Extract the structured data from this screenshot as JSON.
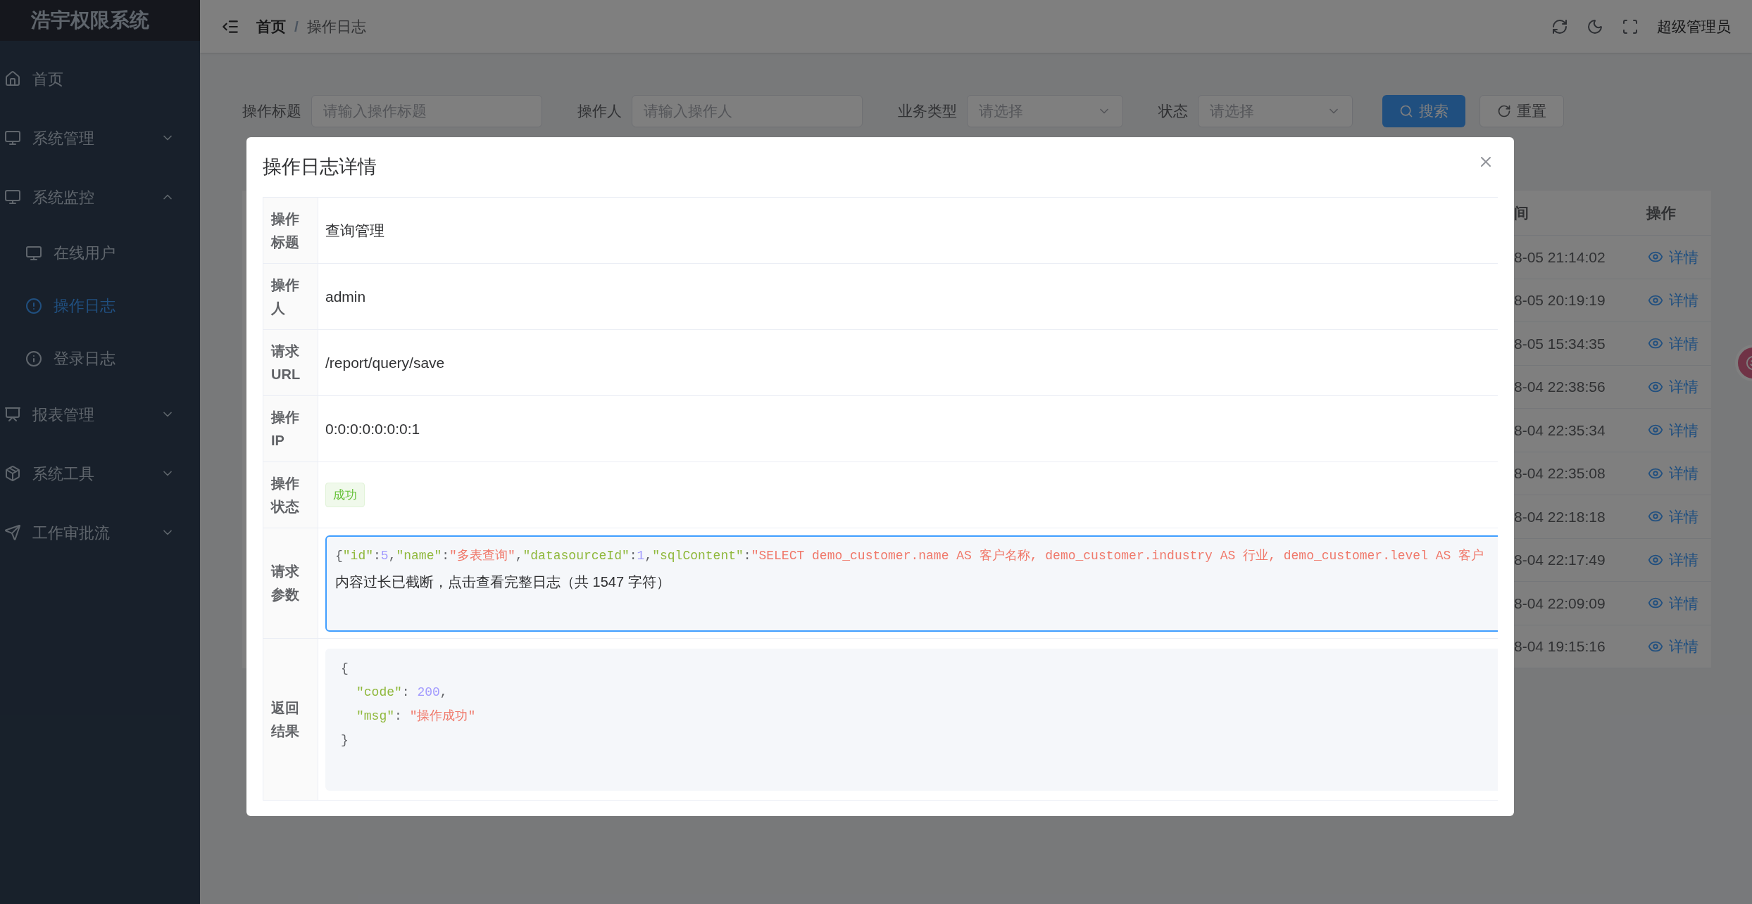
{
  "sidebar": {
    "logo": "浩宇权限系统",
    "items": [
      {
        "label": "首页",
        "kind": "link",
        "selected": false
      },
      {
        "label": "系统管理",
        "kind": "group",
        "expanded": false
      },
      {
        "label": "系统监控",
        "kind": "group",
        "expanded": true,
        "children": [
          {
            "label": "在线用户",
            "selected": false
          },
          {
            "label": "操作日志",
            "selected": true
          },
          {
            "label": "登录日志",
            "selected": false
          }
        ]
      },
      {
        "label": "报表管理",
        "kind": "group",
        "expanded": false
      },
      {
        "label": "系统工具",
        "kind": "group",
        "expanded": false
      },
      {
        "label": "工作审批流",
        "kind": "group",
        "expanded": false
      }
    ]
  },
  "header": {
    "breadcrumb": [
      "首页",
      "操作日志"
    ],
    "separator": "/",
    "user": "超级管理员"
  },
  "search_form": {
    "fields": [
      {
        "label": "操作标题",
        "kind": "text",
        "placeholder": "请输入操作标题"
      },
      {
        "label": "操作人",
        "kind": "text",
        "placeholder": "请输入操作人"
      },
      {
        "label": "业务类型",
        "kind": "select",
        "placeholder": "请选择"
      },
      {
        "label": "状态",
        "kind": "select",
        "placeholder": "请选择"
      }
    ],
    "buttons": [
      {
        "label": "搜索",
        "kind": "primary"
      },
      {
        "label": "重置",
        "kind": "default"
      }
    ]
  },
  "table": {
    "columns": [
      "间",
      "操作"
    ],
    "rows": [
      {
        "time": "8-05 21:14:02",
        "action": "详情"
      },
      {
        "time": "8-05 20:19:19",
        "action": "详情"
      },
      {
        "time": "8-05 15:34:35",
        "action": "详情"
      },
      {
        "time": "8-04 22:38:56",
        "action": "详情"
      },
      {
        "time": "8-04 22:35:34",
        "action": "详情"
      },
      {
        "time": "8-04 22:35:08",
        "action": "详情"
      },
      {
        "time": "8-04 22:18:18",
        "action": "详情"
      },
      {
        "time": "8-04 22:17:49",
        "action": "详情"
      },
      {
        "time": "8-04 22:09:09",
        "action": "详情"
      },
      {
        "time": "8-04 19:15:16",
        "action": "详情"
      }
    ]
  },
  "dialog": {
    "title": "操作日志详情",
    "fields": [
      {
        "label": "操作标题",
        "kind": "text",
        "value": "查询管理"
      },
      {
        "label": "操作人",
        "kind": "text",
        "value": "admin"
      },
      {
        "label": "请求URL",
        "kind": "text",
        "value": "/report/query/save"
      },
      {
        "label": "操作IP",
        "kind": "text",
        "value": "0:0:0:0:0:0:0:1"
      },
      {
        "label": "操作状态",
        "kind": "tag",
        "value": "成功"
      },
      {
        "label": "请求参数",
        "kind": "params",
        "lines": [
          [
            {
              "text": "{",
              "kind": "punct"
            },
            {
              "text": "\"id\"",
              "kind": "key"
            },
            {
              "text": ":",
              "kind": "punct"
            },
            {
              "text": "5",
              "kind": "number"
            },
            {
              "text": ",",
              "kind": "punct"
            },
            {
              "text": "\"name\"",
              "kind": "key"
            },
            {
              "text": ":",
              "kind": "punct"
            },
            {
              "text": "\"多表查询\"",
              "kind": "string"
            },
            {
              "text": ",",
              "kind": "punct"
            },
            {
              "text": "\"datasourceId\"",
              "kind": "key"
            },
            {
              "text": ":",
              "kind": "punct"
            },
            {
              "text": "1",
              "kind": "number"
            },
            {
              "text": ",",
              "kind": "punct"
            },
            {
              "text": "\"sqlContent\"",
              "kind": "key"
            },
            {
              "text": ":",
              "kind": "punct"
            },
            {
              "text": "\"SELECT demo_customer.name AS 客户名称, demo_customer.industry AS 行业, demo_customer.level AS 客户",
              "kind": "string"
            }
          ]
        ],
        "note": "内容过长已截断，点击查看完整日志（共 1547 字符）"
      },
      {
        "label": "返回结果",
        "kind": "json",
        "open": "{",
        "entries": [
          [
            {
              "text": "\"code\"",
              "kind": "key"
            },
            {
              "text": ": ",
              "kind": "punct"
            },
            {
              "text": "200",
              "kind": "number"
            },
            {
              "text": ",",
              "kind": "punct"
            }
          ],
          [
            {
              "text": "\"msg\"",
              "kind": "key"
            },
            {
              "text": ": ",
              "kind": "punct"
            },
            {
              "text": "\"操作成功\"",
              "kind": "string"
            }
          ]
        ],
        "close": "}"
      }
    ]
  }
}
